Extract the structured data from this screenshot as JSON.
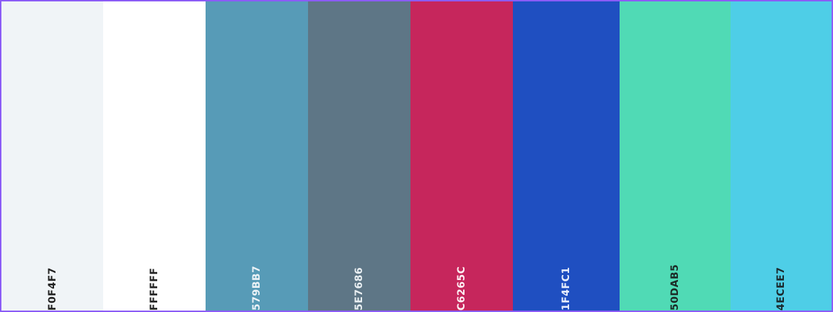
{
  "palette": {
    "swatches": [
      {
        "hex": "F0F4F7",
        "label": "F0F4F7",
        "background": "#F0F4F7",
        "text_color": "#222222"
      },
      {
        "hex": "FFFFFF",
        "label": "FFFFFF",
        "background": "#FFFFFF",
        "text_color": "#222222"
      },
      {
        "hex": "579BB7",
        "label": "579BB7",
        "background": "#579BB7",
        "text_color": "#EAF2F6"
      },
      {
        "hex": "5E7686",
        "label": "5E7686",
        "background": "#5E7686",
        "text_color": "#EAF0F3"
      },
      {
        "hex": "C6265C",
        "label": "C6265C",
        "background": "#C6265C",
        "text_color": "#FDEFF3"
      },
      {
        "hex": "1F4FC1",
        "label": "1F4FC1",
        "background": "#1F4FC1",
        "text_color": "#E9EFFC"
      },
      {
        "hex": "50DAB5",
        "label": "50DAB5",
        "background": "#50DAB5",
        "text_color": "#1C2B27"
      },
      {
        "hex": "4ECEE7",
        "label": "4ECEE7",
        "background": "#4ECEE7",
        "text_color": "#1B2A2E"
      }
    ],
    "border_color": "#8B5CF6"
  }
}
